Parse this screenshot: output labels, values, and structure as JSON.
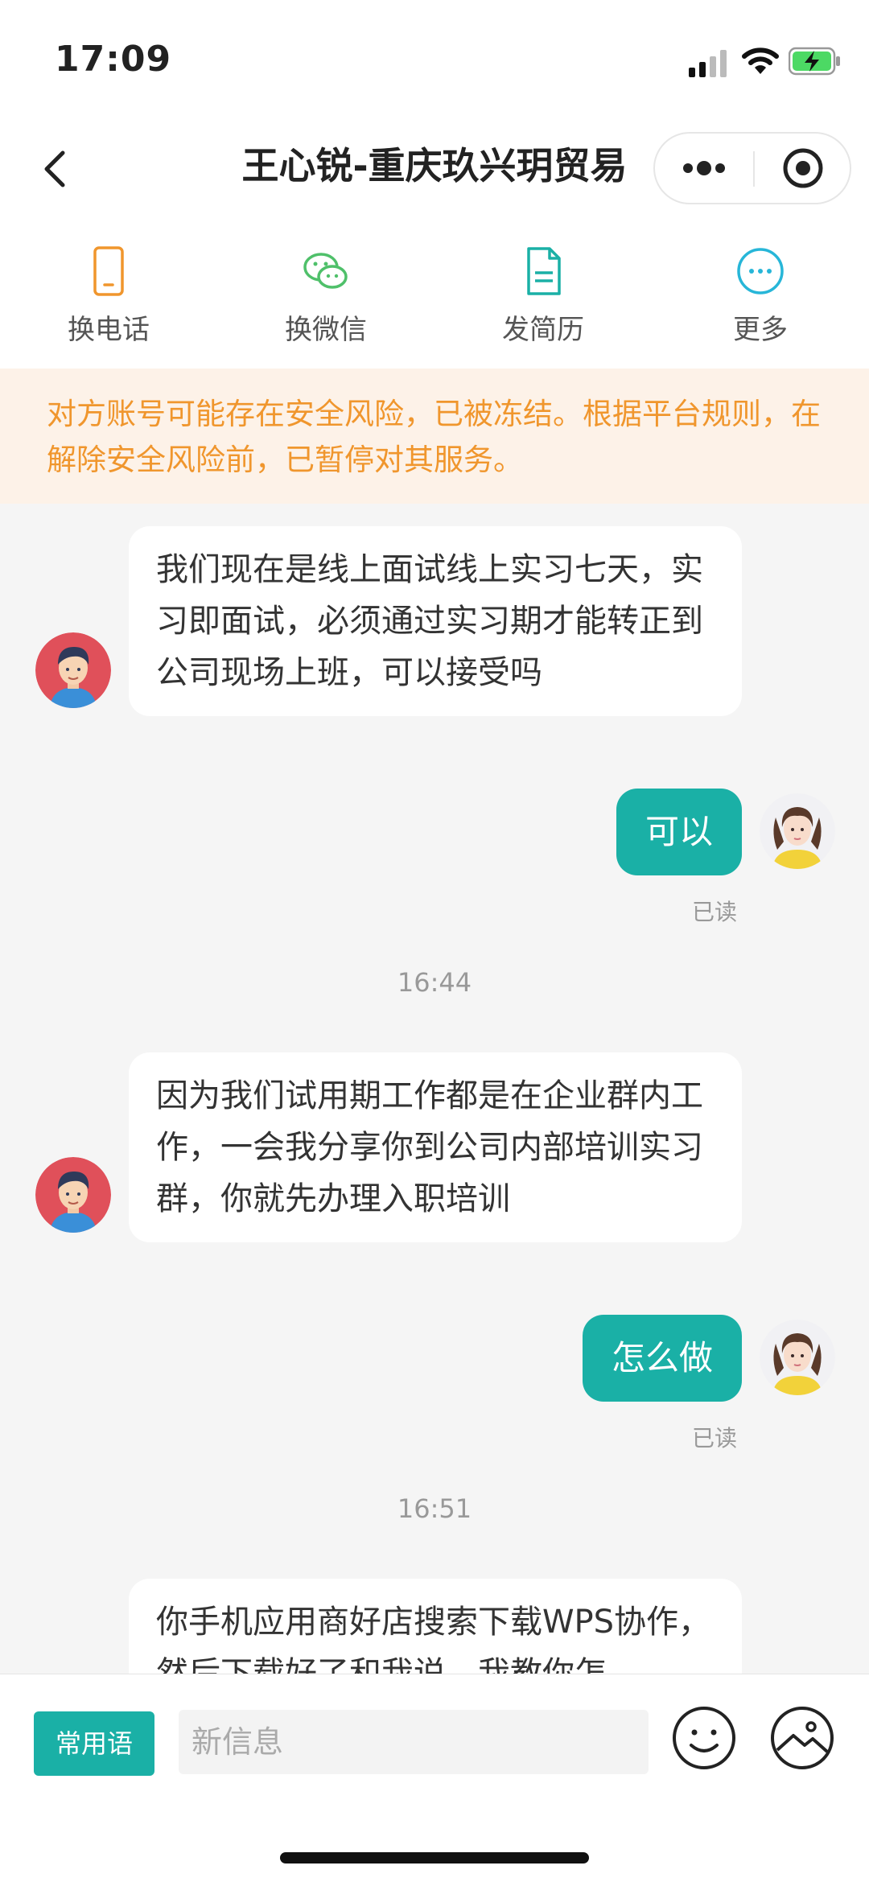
{
  "status_bar": {
    "time": "17:09"
  },
  "nav": {
    "title": "王心锐-重庆玖兴玥贸易"
  },
  "toolbar": [
    {
      "label": "换电话",
      "icon": "phone-icon",
      "color": "#f0962d"
    },
    {
      "label": "换微信",
      "icon": "wechat-icon",
      "color": "#4fc06a"
    },
    {
      "label": "发简历",
      "icon": "resume-icon",
      "color": "#1ab0a6"
    },
    {
      "label": "更多",
      "icon": "more-icon",
      "color": "#27b6d8"
    }
  ],
  "notice": "对方账号可能存在安全风险，已被冻结。根据平台规则，在解除安全风险前，已暂停对其服务。",
  "messages": [
    {
      "from": "other",
      "text": "我们现在是线上面试线上实习七天，实习即面试，必须通过实习期才能转正到公司现场上班，可以接受吗"
    },
    {
      "from": "me",
      "text": "可以",
      "status": "已读"
    },
    {
      "type": "time",
      "text": "16:44"
    },
    {
      "from": "other",
      "text": "因为我们试用期工作都是在企业群内工作，一会我分享你到公司内部培训实习群，你就先办理入职培训"
    },
    {
      "from": "me",
      "text": "怎么做",
      "status": "已读"
    },
    {
      "type": "time",
      "text": "16:51"
    },
    {
      "from": "other",
      "text": "你手机应用商好店搜索下载WPS协作，然后下载好了和我说，我教你怎"
    }
  ],
  "input_bar": {
    "phrase_label": "常用语",
    "placeholder": "新信息"
  },
  "colors": {
    "accent": "#1ab0a6",
    "notice_text": "#f0962d",
    "notice_bg": "#fdf2e8"
  }
}
